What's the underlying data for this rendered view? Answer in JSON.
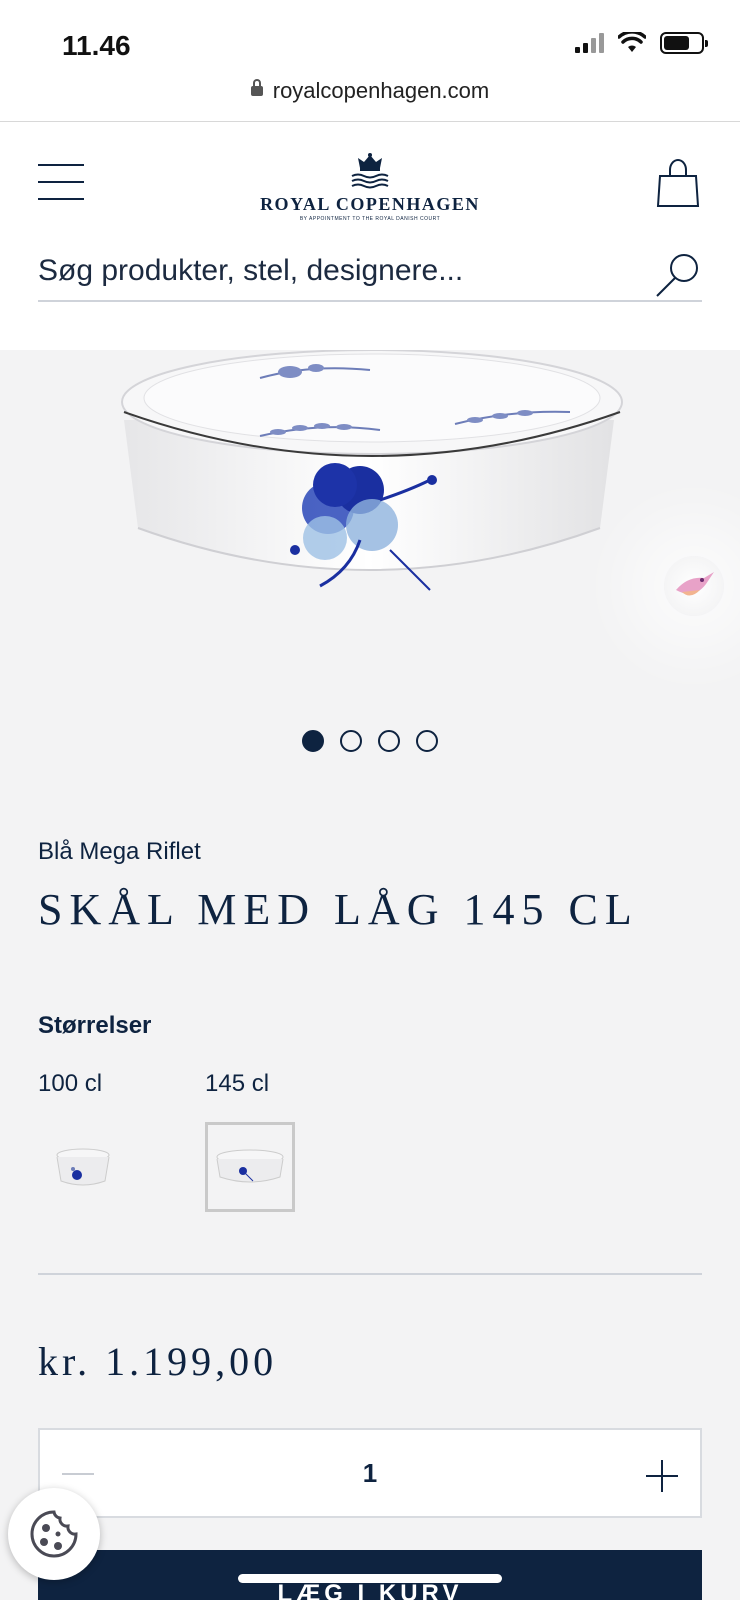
{
  "status_bar": {
    "time": "11.46",
    "url": "royalcopenhagen.com"
  },
  "header": {
    "logo_text": "ROYAL COPENHAGEN",
    "logo_sub": "BY APPOINTMENT TO THE ROYAL DANISH COURT",
    "search_placeholder": "Søg produkter, stel, designere..."
  },
  "gallery": {
    "slides": 4,
    "active_slide": 1
  },
  "product": {
    "collection": "Blå Mega Riflet",
    "title": "SKÅL MED LÅG 145 CL",
    "sizes_label": "Størrelser",
    "sizes": [
      {
        "label": "100 cl",
        "selected": false
      },
      {
        "label": "145 cl",
        "selected": true
      }
    ],
    "price": "kr. 1.199,00",
    "quantity": "1",
    "add_to_cart": "LÆG I KURV"
  },
  "colors": {
    "navy": "#0e2340",
    "background": "#f3f3f4",
    "pattern_blue": "#1a2fa0"
  }
}
